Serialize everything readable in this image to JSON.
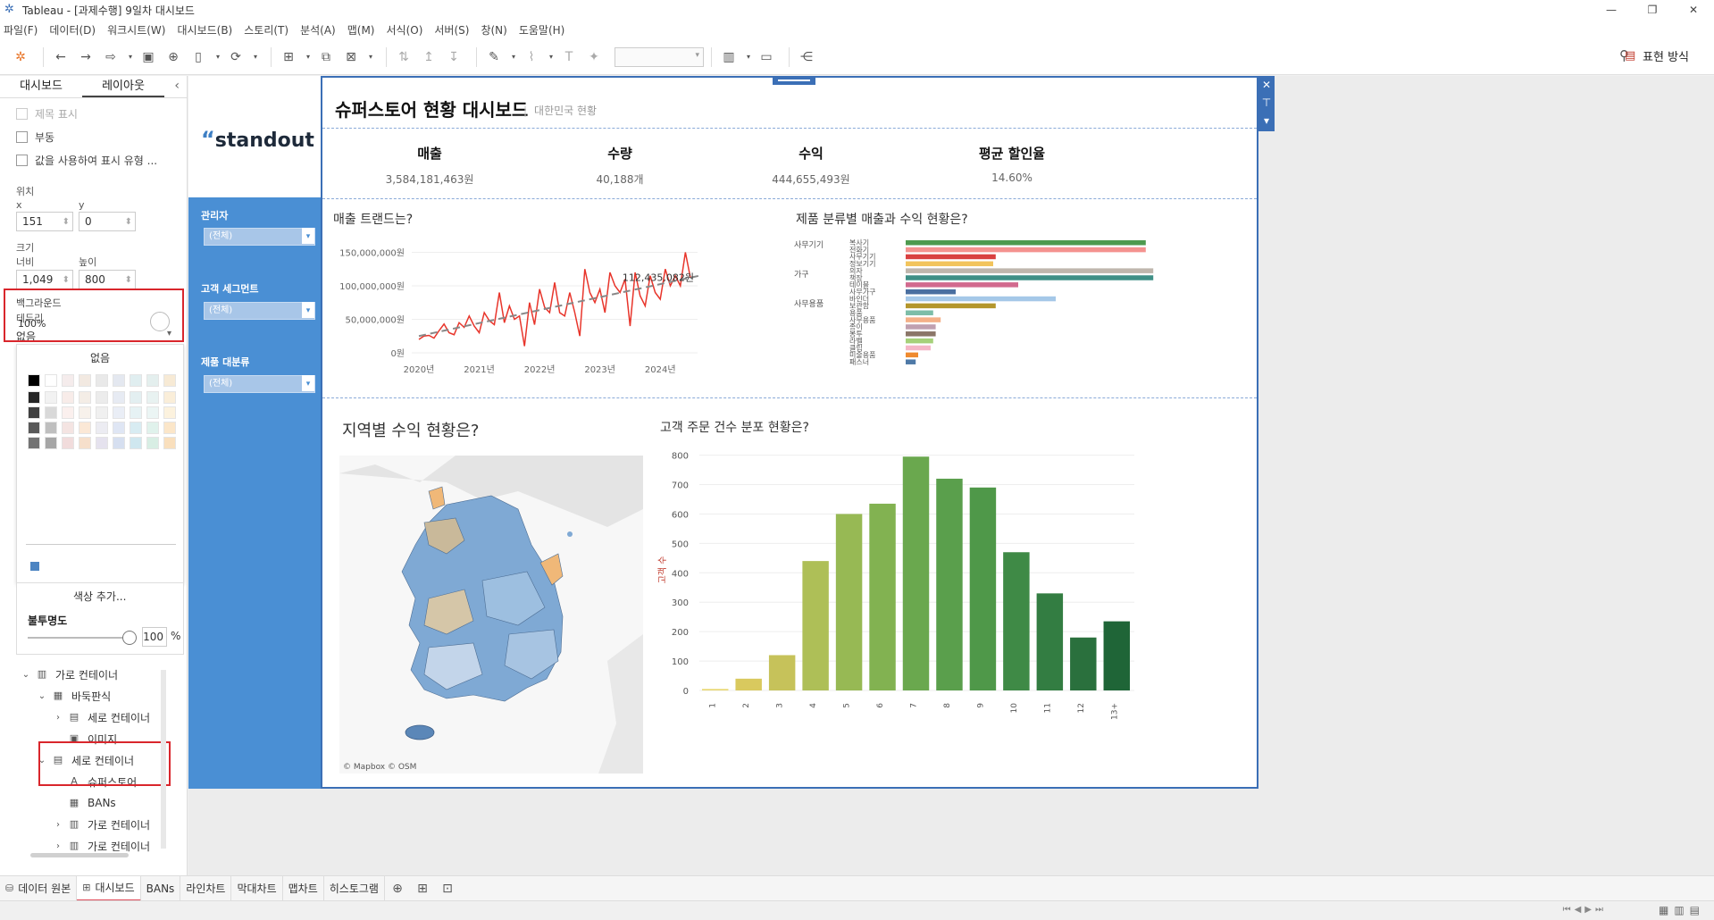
{
  "window": {
    "title": "Tableau - [과제수행] 9일차 대시보드",
    "controls": [
      "—",
      "❐",
      "✕"
    ]
  },
  "menu": [
    "파일(F)",
    "데이터(D)",
    "워크시트(W)",
    "대시보드(B)",
    "스토리(T)",
    "분석(A)",
    "맵(M)",
    "서식(O)",
    "서버(S)",
    "창(N)",
    "도움말(H)"
  ],
  "toolbar": {
    "show_me": "표현 방식"
  },
  "left_panel": {
    "tabs": [
      "대시보드",
      "레이아웃"
    ],
    "show_title": "제목 표시",
    "floating": "부동",
    "show_with_value": "값을 사용하여 표시 유형 ...",
    "position_label": "위치",
    "x_label": "x",
    "y_label": "y",
    "x_value": "151",
    "y_value": "0",
    "size_label": "크기",
    "width_label": "너비",
    "height_label": "높이",
    "width_value": "1,049",
    "height_value": "800",
    "border_label": "테두리",
    "border_value": "없음",
    "background_label": "백그라운드",
    "background_pct": "100%",
    "palette_none": "없음",
    "add_color": "색상 추가...",
    "opacity_label": "불투명도",
    "opacity_value": "100",
    "opacity_unit": "%",
    "tree": [
      {
        "label": "가로 컨테이너",
        "indent": 0,
        "arrow": "⌄",
        "icon": "▥"
      },
      {
        "label": "바둑판식",
        "indent": 1,
        "arrow": "⌄",
        "icon": "▦"
      },
      {
        "label": "세로 컨테이너",
        "indent": 2,
        "arrow": "›",
        "icon": "▤"
      },
      {
        "label": "이미지",
        "indent": 2,
        "arrow": "",
        "icon": "▣"
      },
      {
        "label": "세로 컨테이너",
        "indent": 1,
        "arrow": "⌄",
        "icon": "▤"
      },
      {
        "label": "슈퍼스토어",
        "indent": 2,
        "arrow": "",
        "icon": "A"
      },
      {
        "label": "BANs",
        "indent": 2,
        "arrow": "",
        "icon": "▦"
      },
      {
        "label": "가로 컨테이너",
        "indent": 2,
        "arrow": "›",
        "icon": "▥"
      },
      {
        "label": "가로 컨테이너",
        "indent": 2,
        "arrow": "›",
        "icon": "▥"
      }
    ]
  },
  "dashboard": {
    "logo": "standout",
    "title": "슈퍼스토어 현황 대시보드",
    "subtitle": "대한민국 현황",
    "filters": [
      {
        "title": "관리자",
        "value": "(전체)"
      },
      {
        "title": "고객 세그먼트",
        "value": "(전체)"
      },
      {
        "title": "제품 대분류",
        "value": "(전체)"
      }
    ],
    "bans": [
      {
        "label": "매출",
        "value": "3,584,181,463원"
      },
      {
        "label": "수량",
        "value": "40,188개"
      },
      {
        "label": "수익",
        "value": "444,655,493원"
      },
      {
        "label": "평균 할인율",
        "value": "14.60%"
      }
    ],
    "titles": {
      "trend": "매출 트랜드는?",
      "product": "제품 분류별 매출과 수익 현황은?",
      "map": "지역별 수익 현황은?",
      "hist": "고객 주문 건수 분포 현황은?"
    },
    "map_credit": "© Mapbox © OSM"
  },
  "chart_data": [
    {
      "type": "line",
      "x": [
        "2020-01",
        "2020-02",
        "2020-03",
        "2020-04",
        "2020-05",
        "2020-06",
        "2020-07",
        "2020-08",
        "2020-09",
        "2020-10",
        "2020-11",
        "2020-12",
        "2021-01",
        "2021-02",
        "2021-03",
        "2021-04",
        "2021-05",
        "2021-06",
        "2021-07",
        "2021-08",
        "2021-09",
        "2021-10",
        "2021-11",
        "2021-12",
        "2022-01",
        "2022-02",
        "2022-03",
        "2022-04",
        "2022-05",
        "2022-06",
        "2022-07",
        "2022-08",
        "2022-09",
        "2022-10",
        "2022-11",
        "2022-12",
        "2023-01",
        "2023-02",
        "2023-03",
        "2023-04",
        "2023-05",
        "2023-06",
        "2023-07",
        "2023-08",
        "2023-09",
        "2023-10",
        "2023-11",
        "2023-12",
        "2024-01",
        "2024-02",
        "2024-03",
        "2024-04",
        "2024-05",
        "2024-06",
        "2024-07"
      ],
      "series": [
        {
          "values": [
            20000000,
            25000000,
            26000000,
            22000000,
            33000000,
            43000000,
            30000000,
            27000000,
            45000000,
            38000000,
            55000000,
            40000000,
            30000000,
            60000000,
            48000000,
            42000000,
            90000000,
            45000000,
            70000000,
            50000000,
            55000000,
            10000000,
            75000000,
            42000000,
            95000000,
            68000000,
            60000000,
            105000000,
            60000000,
            55000000,
            90000000,
            60000000,
            25000000,
            125000000,
            90000000,
            75000000,
            95000000,
            60000000,
            120000000,
            100000000,
            90000000,
            110000000,
            40000000,
            120000000,
            85000000,
            70000000,
            115000000,
            90000000,
            80000000,
            125000000,
            100000000,
            115000000,
            100000000,
            150000000,
            112000000
          ]
        },
        {
          "name": "trend",
          "values": [
            25000000,
            112435082
          ]
        }
      ],
      "trend_label": "112,435,082원",
      "yticks": [
        "150,000,000원",
        "100,000,000원",
        "50,000,000원",
        "0원"
      ],
      "xticks": [
        "2020년",
        "2021년",
        "2022년",
        "2023년",
        "2024년"
      ],
      "ylim": [
        0,
        160000000
      ],
      "colors": {
        "line": "#e8352b",
        "trend": "#888888"
      }
    },
    {
      "type": "bar",
      "groups": [
        "사무기기",
        "가구",
        "사무용품"
      ],
      "categories": [
        "복사기",
        "전화기",
        "사무기기",
        "정보기기",
        "의자",
        "책장",
        "테이블",
        "사무가구",
        "바인더",
        "보관함",
        "용품",
        "사무용품",
        "종이",
        "봉투",
        "라벨",
        "클립",
        "미술용품",
        "패스너"
      ],
      "category_labels": [
        "복사기",
        "전화기",
        "사무기기",
        "정보기기",
        "의자",
        "책장",
        "테이블",
        "사무가구",
        "바인더",
        "보관함",
        "용품",
        "사무용품",
        "종이",
        "봉투",
        "라벨",
        "클립",
        "미술용품",
        "패스너"
      ],
      "values": [
        0.96,
        0.96,
        0.36,
        0.35,
        0.99,
        0.99,
        0.45,
        0.2,
        0.6,
        0.36,
        0.11,
        0.14,
        0.12,
        0.12,
        0.11,
        0.1,
        0.05,
        0.04
      ],
      "colors": [
        "#4e9a4f",
        "#f4928f",
        "#d94040",
        "#f2c45c",
        "#bfb6ad",
        "#3f8f86",
        "#d26a8e",
        "#4a6fa0",
        "#a5c8e8",
        "#b4962c",
        "#7dbda8",
        "#f4b088",
        "#c0a0b0",
        "#8b7668",
        "#a6d17a",
        "#f5b6c7",
        "#ef8a2f",
        "#4e79a7"
      ]
    },
    {
      "type": "bar",
      "categories": [
        "1",
        "2",
        "3",
        "4",
        "5",
        "6",
        "7",
        "8",
        "9",
        "10",
        "11",
        "12",
        "13+"
      ],
      "values": [
        5,
        40,
        120,
        440,
        600,
        635,
        795,
        720,
        690,
        470,
        330,
        180,
        235
      ],
      "ylabel": "고객 수",
      "yticks": [
        0,
        100,
        200,
        300,
        400,
        500,
        600,
        700,
        800
      ],
      "ylim": [
        0,
        820
      ],
      "colors": [
        "#e8d770",
        "#d9c95e",
        "#c6c25a",
        "#aebf57",
        "#97b954",
        "#82b251",
        "#6aa84e",
        "#5a9f4c",
        "#4f9849",
        "#3f8a46",
        "#337d42",
        "#2a703d",
        "#1f6537"
      ]
    }
  ],
  "sheets": [
    "데이터 원본",
    "대시보드",
    "BANs",
    "라인차트",
    "막대차트",
    "맵차트",
    "히스토그램"
  ]
}
